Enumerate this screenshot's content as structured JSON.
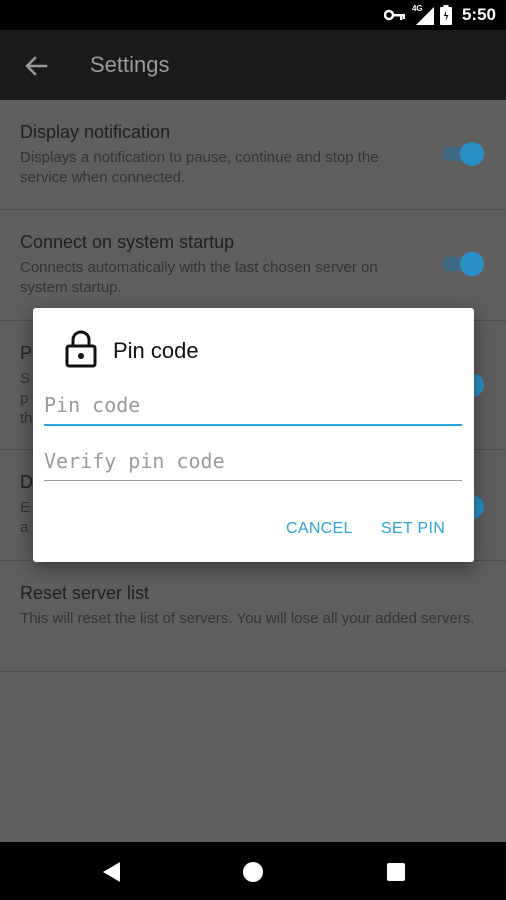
{
  "status_bar": {
    "network_label": "4G",
    "time": "5:50"
  },
  "app_bar": {
    "title": "Settings"
  },
  "settings": [
    {
      "title": "Display notification",
      "description": "Displays a notification to pause, continue and stop the service when connected.",
      "enabled": true
    },
    {
      "title": "Connect on system startup",
      "description": "Connects automatically with the last chosen server on system startup.",
      "enabled": true
    },
    {
      "title": "P",
      "description": "S\np\nth",
      "enabled": true
    },
    {
      "title": "D",
      "description": "E\na",
      "enabled": true
    },
    {
      "title": "Reset server list",
      "description": "This will reset the list of servers. You will lose all your added servers."
    }
  ],
  "dialog": {
    "title": "Pin code",
    "pin_field": {
      "value": "",
      "placeholder": "Pin code"
    },
    "verify_field": {
      "value": "",
      "placeholder": "Verify pin code"
    },
    "cancel_label": "CANCEL",
    "confirm_label": "SET PIN"
  },
  "colors": {
    "accent": "#2aa3d6",
    "toggle_on": "#2a8fc4",
    "scrim_background": "#5f5f5f",
    "appbar": "#1a1a1a"
  },
  "icons": [
    "key-icon",
    "signal-icon",
    "battery-icon",
    "back-arrow-icon",
    "lock-icon",
    "nav-back-icon",
    "nav-home-icon",
    "nav-recents-icon"
  ]
}
